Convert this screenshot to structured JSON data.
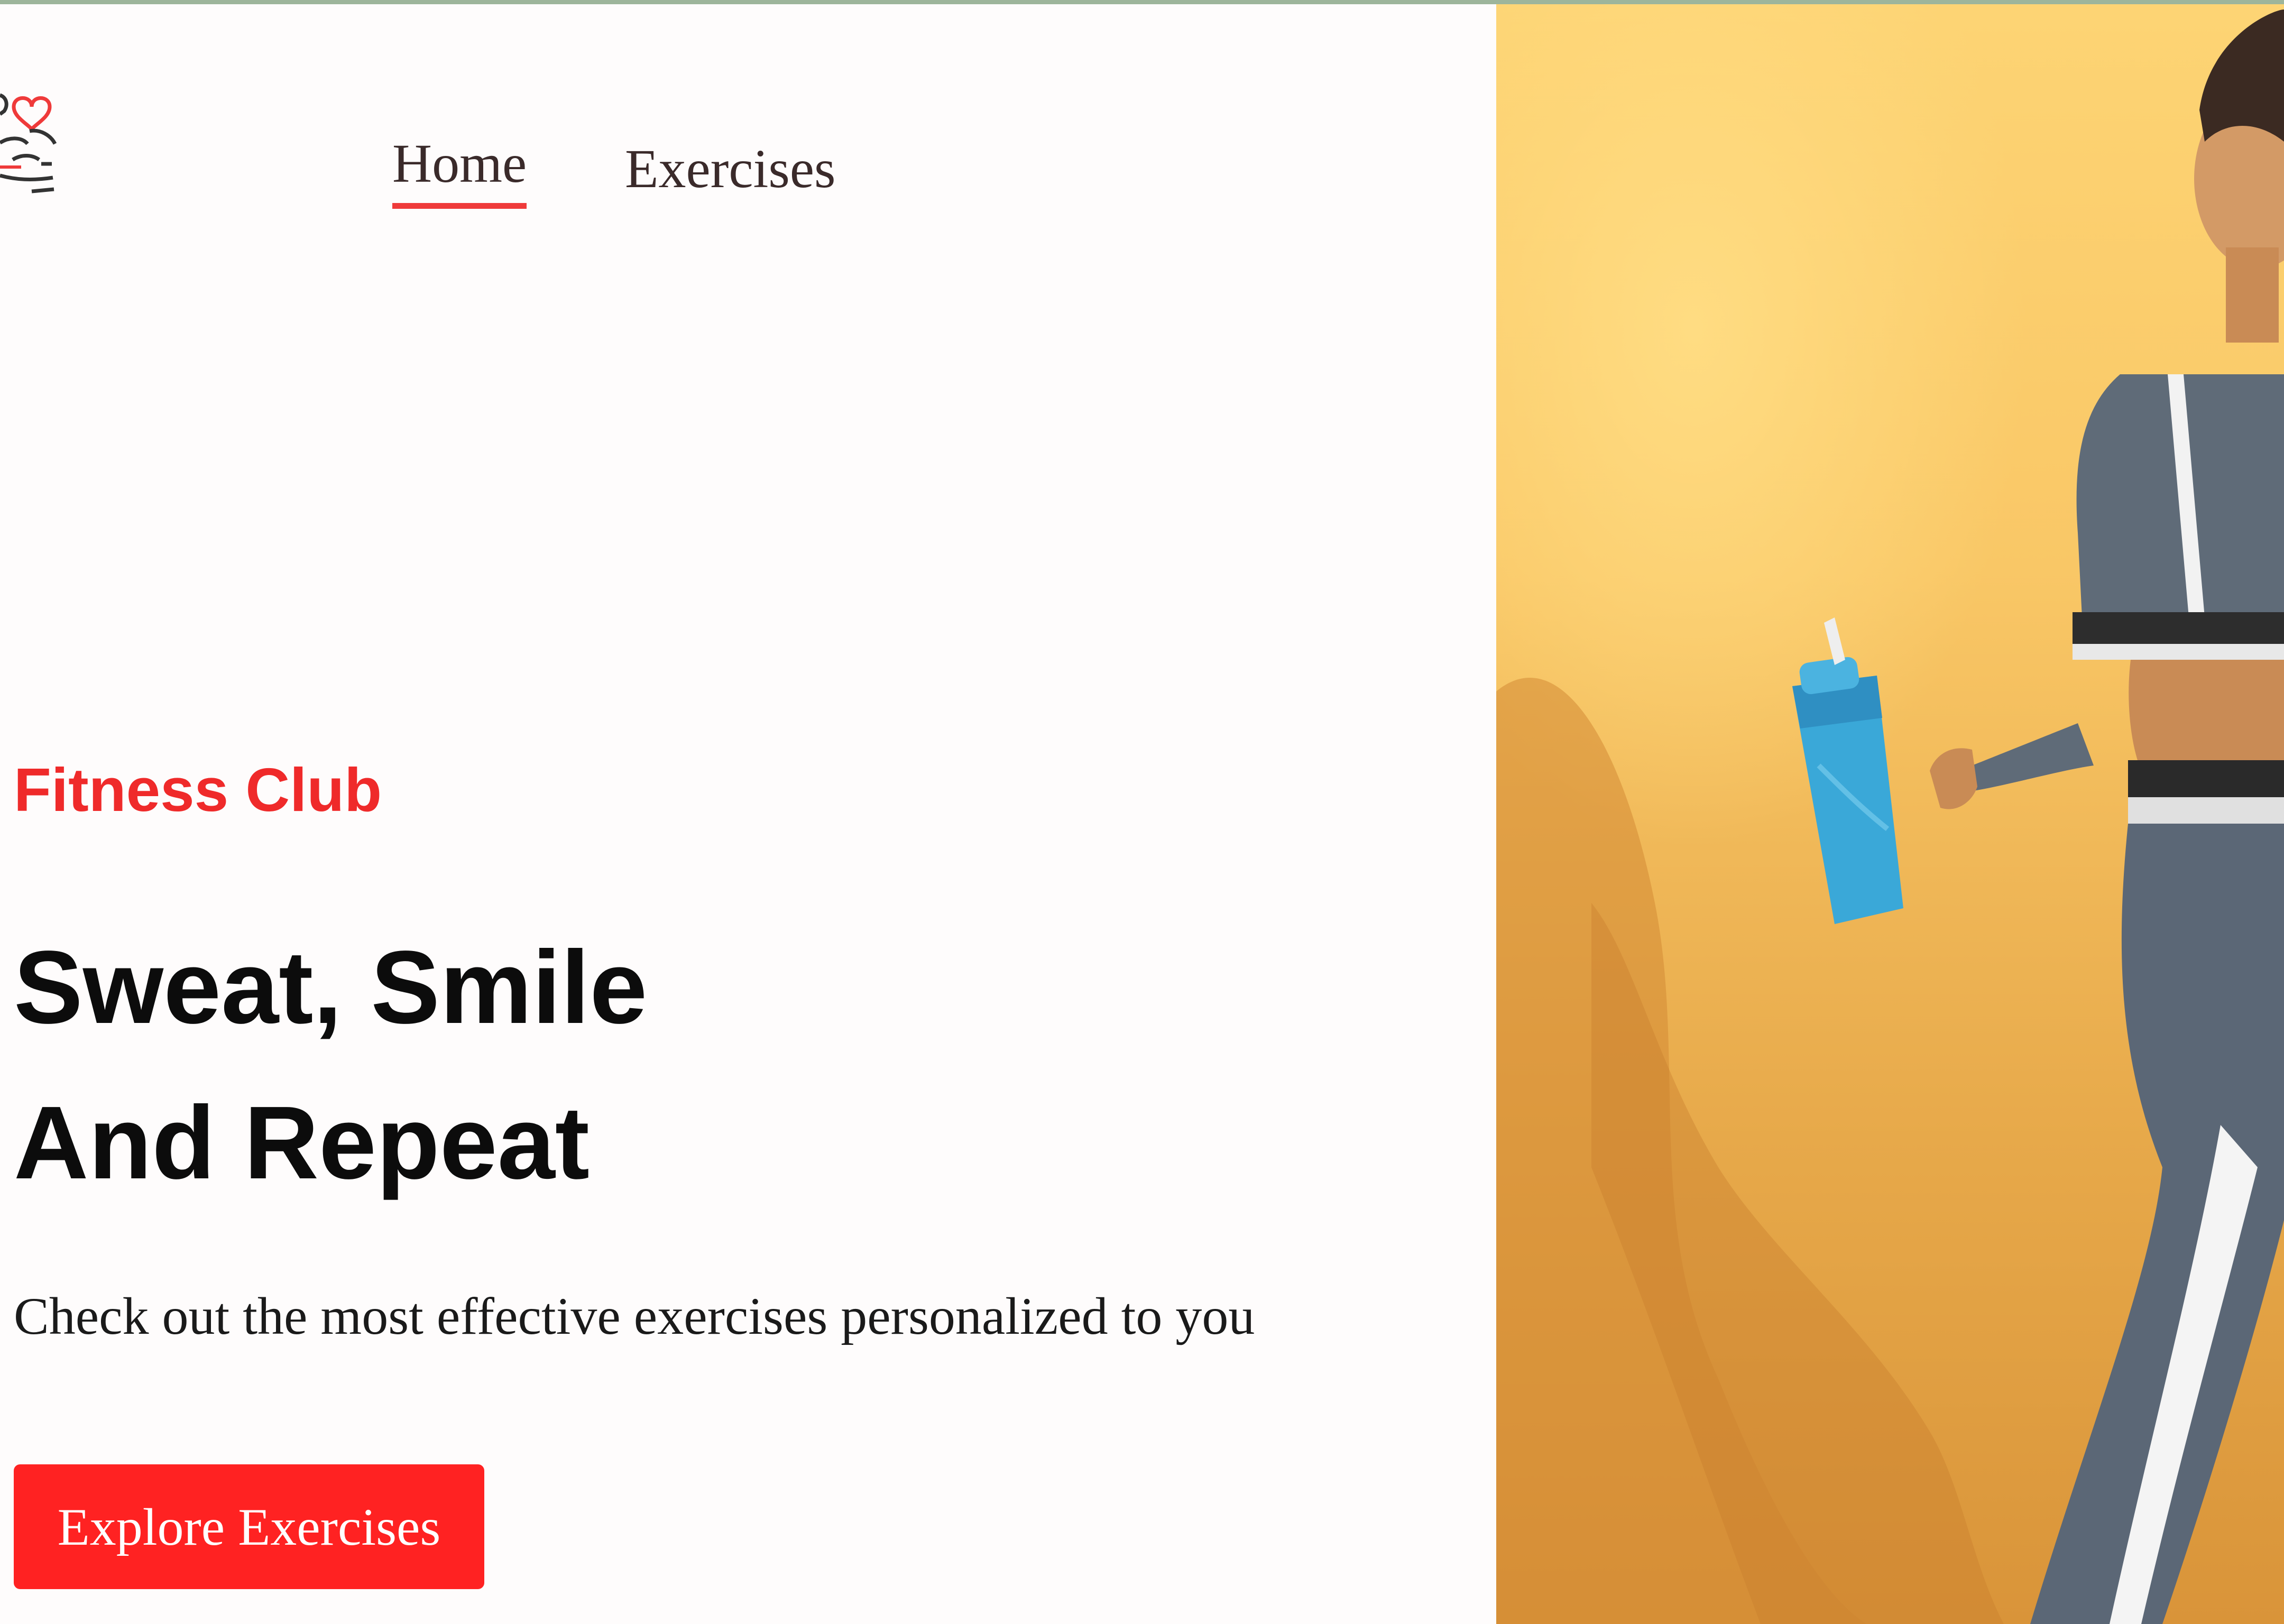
{
  "nav": {
    "links": [
      {
        "label": "Home",
        "active": true
      },
      {
        "label": "Exercises",
        "active": false
      }
    ]
  },
  "hero": {
    "kicker": "Fitness Club",
    "headline_line1": "Sweat, Smile",
    "headline_line2": "And Repeat",
    "subtitle": "Check out the most effective exercises personalized to you",
    "cta_label": "Explore Exercises"
  },
  "colors": {
    "accent": "#ff2222",
    "accent_text": "#ef2a2a",
    "page_background": "#fefcfc",
    "image_background": "#fdd474"
  },
  "icons": {
    "logo": "gym-heart-logo-icon"
  }
}
